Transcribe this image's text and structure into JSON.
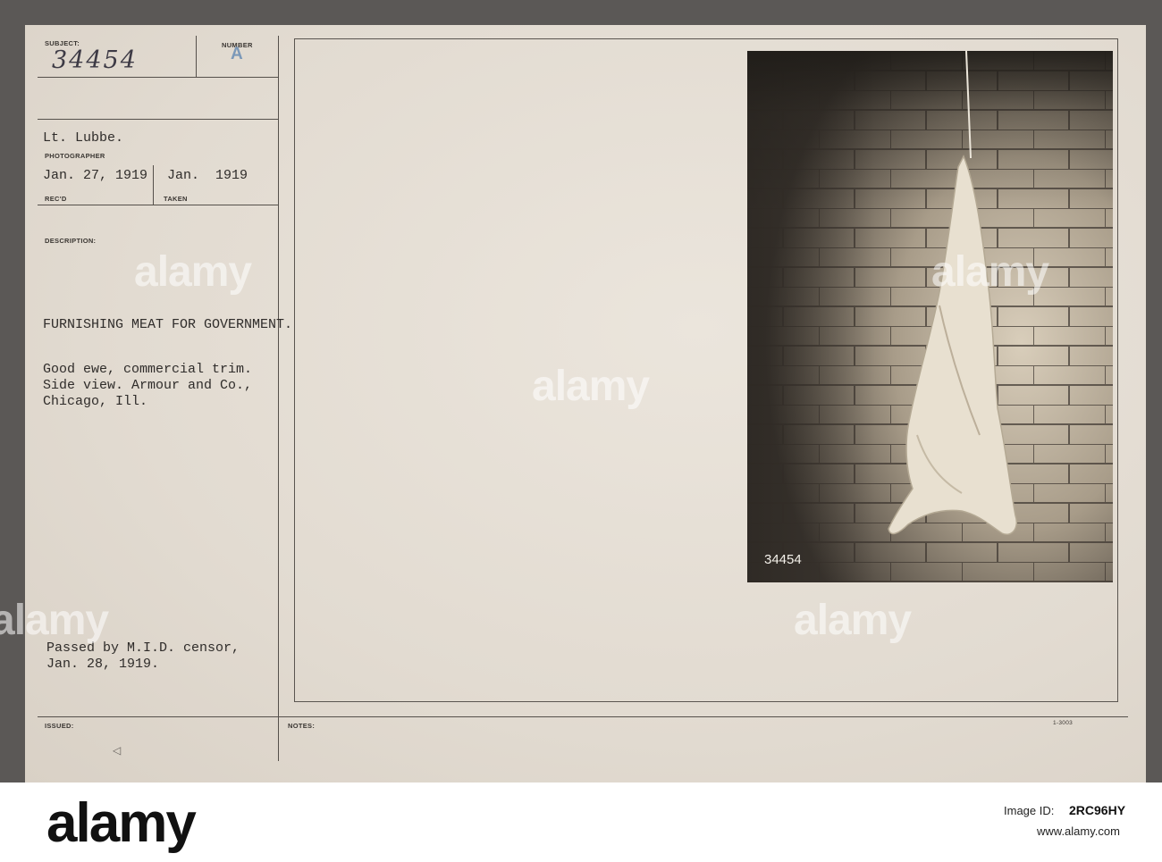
{
  "card": {
    "subject_label": "SUBJECT:",
    "subject_value": "34454",
    "number_label": "NUMBER",
    "number_value": "A",
    "photographer_name": "Lt. Lubbe.",
    "photographer_label": "PHOTOGRAPHER",
    "recd_value": "Jan. 27, 1919",
    "recd_label": "REC'D",
    "taken_value": "Jan.  1919",
    "taken_label": "TAKEN",
    "description_label": "DESCRIPTION:",
    "description_title": "FURNISHING MEAT FOR GOVERNMENT.",
    "description_lines": [
      "Good ewe, commercial trim.",
      "Side view. Armour and Co.,",
      "Chicago, Ill."
    ],
    "censor_lines": [
      "Passed by M.I.D. censor,",
      "Jan. 28, 1919."
    ],
    "issued_label": "ISSUED:",
    "notes_label": "NOTES:",
    "form_code": "1-3003",
    "photo_stamp": "34454"
  },
  "watermark": "alamy",
  "footer": {
    "logo": "alamy",
    "image_id_label": "Image ID:",
    "image_id": "2RC96HY",
    "url": "www.alamy.com"
  },
  "colors": {
    "paper": "#e4ddd3",
    "ink": "#2f2c2a",
    "stamp_blue": "#7b98b8",
    "border": "#5b5856"
  }
}
